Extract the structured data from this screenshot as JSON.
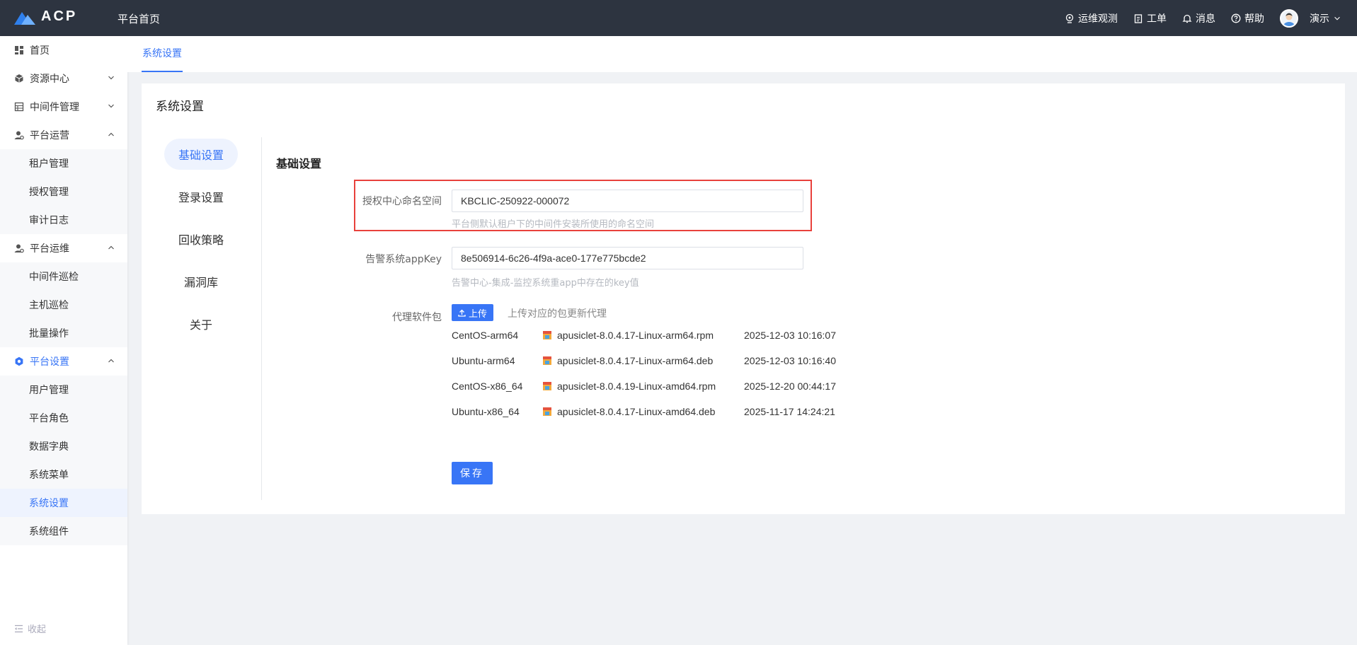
{
  "header": {
    "logo_text": "ACP",
    "home_title": "平台首页",
    "nav": [
      {
        "label": "运维观测",
        "icon": "monitor-icon"
      },
      {
        "label": "工单",
        "icon": "clipboard-icon"
      },
      {
        "label": "消息",
        "icon": "bell-icon"
      },
      {
        "label": "帮助",
        "icon": "help-icon"
      }
    ],
    "user_name": "演示"
  },
  "sidebar": {
    "items": [
      {
        "label": "首页",
        "icon": "dashboard-icon"
      },
      {
        "label": "资源中心",
        "icon": "cube-icon"
      },
      {
        "label": "中间件管理",
        "icon": "server-icon"
      },
      {
        "label": "平台运营",
        "icon": "user-gear-icon"
      },
      {
        "label": "平台运维",
        "icon": "user-gear-icon"
      },
      {
        "label": "平台设置",
        "icon": "settings-icon"
      }
    ],
    "ops_children": [
      "租户管理",
      "授权管理",
      "审计日志"
    ],
    "maint_children": [
      "中间件巡检",
      "主机巡检",
      "批量操作"
    ],
    "settings_children": [
      "用户管理",
      "平台角色",
      "数据字典",
      "系统菜单",
      "系统设置",
      "系统组件"
    ],
    "collapse_label": "收起"
  },
  "tabbar": {
    "active_tab": "系统设置"
  },
  "panel": {
    "title": "系统设置",
    "vtabs": [
      "基础设置",
      "登录设置",
      "回收策略",
      "漏洞库",
      "关于"
    ],
    "section_title": "基础设置"
  },
  "form": {
    "namespace_label": "授权中心命名空间",
    "namespace_value": "KBCLIC-250922-000072",
    "namespace_hint": "平台侧默认租户下的中间件安装所使用的命名空间",
    "appkey_label": "告警系统appKey",
    "appkey_value": "8e506914-6c26-4f9a-ace0-177e775bcde2",
    "appkey_hint": "告警中心-集成-监控系统重app中存在的key值",
    "agent_label": "代理软件包",
    "upload_label": "上传",
    "upload_hint": "上传对应的包更新代理",
    "packages": [
      {
        "os": "CentOS-arm64",
        "file": "apusiclet-8.0.4.17-Linux-arm64.rpm",
        "time": "2025-12-03 10:16:07"
      },
      {
        "os": "Ubuntu-arm64",
        "file": "apusiclet-8.0.4.17-Linux-arm64.deb",
        "time": "2025-12-03 10:16:40"
      },
      {
        "os": "CentOS-x86_64",
        "file": "apusiclet-8.0.4.19-Linux-amd64.rpm",
        "time": "2025-12-20 00:44:17"
      },
      {
        "os": "Ubuntu-x86_64",
        "file": "apusiclet-8.0.4.17-Linux-amd64.deb",
        "time": "2025-11-17 14:24:21"
      }
    ],
    "save_label": "保存"
  },
  "colors": {
    "primary": "#3875f6",
    "header_bg": "#2d3440",
    "highlight_border": "#e8413c"
  }
}
